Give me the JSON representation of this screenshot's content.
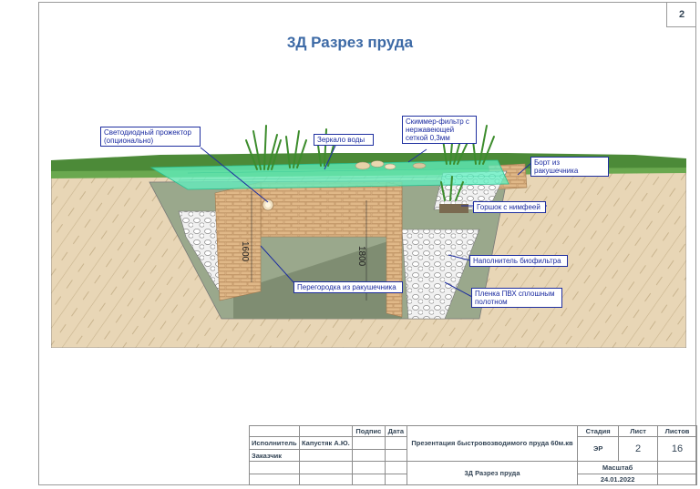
{
  "page_number": "2",
  "title": "3Д Разрез пруда",
  "labels": {
    "led": "Светодиодный прожектор (опционально)",
    "mirror": "Зеркало воды",
    "skimmer": "Скиммер-фильтр с нержавеющей сеткой 0,3мм",
    "border": "Борт из ракушечника",
    "pot": "Горшок с нимфеей",
    "filler": "Наполнитель биофильтра",
    "partition": "Перегородка из ракушечника",
    "film": "Пленка ПВХ сплошным полотном"
  },
  "dims": {
    "left": "1600",
    "center": "1800"
  },
  "title_block": {
    "h_podpis": "Подпис",
    "h_data": "Дата",
    "ispolnitel_label": "Исполнитель",
    "ispolnitel_name": "Капустяк А.Ю.",
    "zakazchik_label": "Заказчик",
    "project": "Презентация быстровозводимого пруда 60м.кв",
    "sheet_title": "3Д Разрез пруда",
    "h_stage": "Стадия",
    "h_sheet": "Лист",
    "h_sheets": "Листов",
    "stage": "ЭР",
    "sheet": "2",
    "sheets": "16",
    "scale_label": "Масштаб",
    "date": "24.01.2022"
  },
  "colors": {
    "title": "#3d6aa6",
    "callout_border": "#1f2fa0",
    "water": "#5ff0c0",
    "brick": "#e0b888",
    "soil": "#e8d6b6",
    "grass": "#4c8a38"
  }
}
